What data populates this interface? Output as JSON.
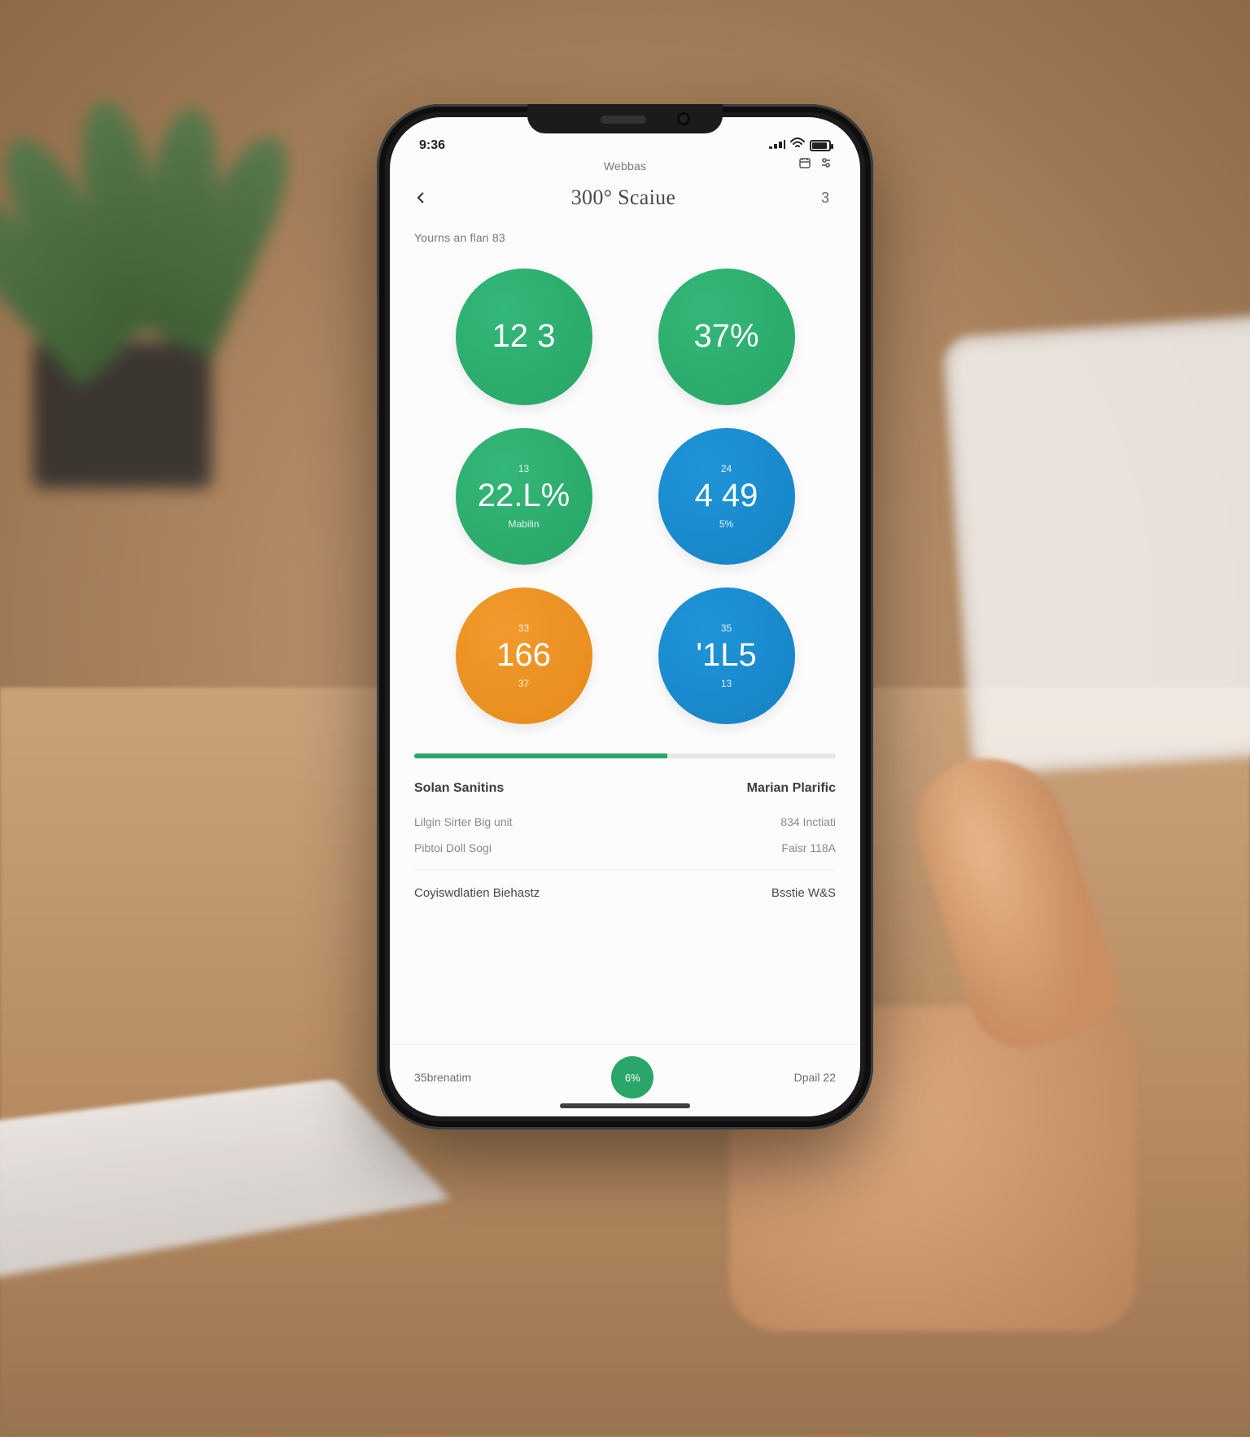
{
  "status": {
    "time": "9:36",
    "carrier_area": "",
    "right_icons": [
      "signal",
      "wifi",
      "battery"
    ]
  },
  "header": {
    "super_label": "Webbas",
    "title": "300° Scaiue",
    "right_glyph": "3",
    "right_icons": [
      "calendar",
      "tune"
    ]
  },
  "subtitle": "Yourns an flan 83",
  "circles": [
    {
      "top": "",
      "value": "12 3",
      "bottom": "",
      "color": "green"
    },
    {
      "top": "",
      "value": "37%",
      "bottom": "",
      "color": "green"
    },
    {
      "top": "13",
      "value": "22.L%",
      "bottom": "Mabilin",
      "color": "green"
    },
    {
      "top": "24",
      "value": "4 49",
      "bottom": "5%",
      "color": "blue"
    },
    {
      "top": "33",
      "value": "166",
      "bottom": "37",
      "color": "orange"
    },
    {
      "top": "35",
      "value": "'1L5",
      "bottom": "13",
      "color": "blue"
    }
  ],
  "progress": {
    "pct": 60
  },
  "list": {
    "left_header": "Solan Sanitins",
    "right_header": "Marian Plarific",
    "rows": [
      {
        "left": "Lilgin Sirter Big unit",
        "right": "834 Inctiati"
      },
      {
        "left": "Pibtoi Doll Sogi",
        "right": "Faisr 118A"
      },
      {
        "left": "Coyiswdlatien Biehastz",
        "right": "Bsstie W&S",
        "strong": true
      }
    ]
  },
  "nav": {
    "left": "35brenatim",
    "center": "6%",
    "right": "Dpail 22"
  },
  "colors": {
    "green": "#2aa66a",
    "blue": "#1682c4",
    "orange": "#e78a1a"
  }
}
